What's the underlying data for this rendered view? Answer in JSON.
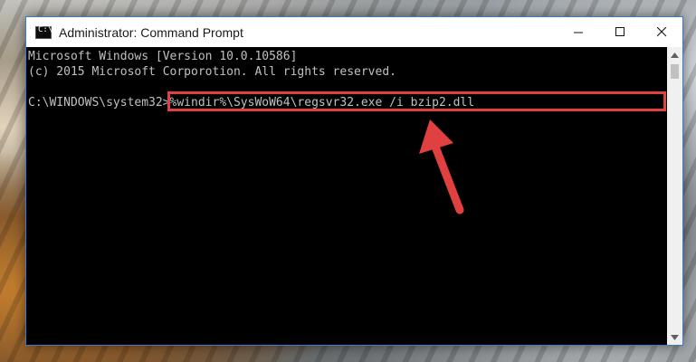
{
  "window": {
    "title": "Administrator: Command Prompt",
    "app_icon_glyph": "C:\\",
    "controls": {
      "minimize_icon": "minimize-icon",
      "maximize_icon": "maximize-icon",
      "close_icon": "close-icon"
    }
  },
  "console": {
    "lines": [
      "Microsoft Windows [Version 10.0.10586]",
      "(c) 2015 Microsoft Corporotion. All rights reserved.",
      "",
      "C:\\WINDOWS\\system32>%windir%\\SysWoW64\\regsvr32.exe /i bzip2.dll"
    ]
  },
  "annotation": {
    "highlight_color": "#e0403f",
    "arrow_icon": "red-arrow-icon"
  },
  "colors": {
    "console_bg": "#000000",
    "console_text": "#c0c0c0",
    "window_border": "#3a7bd5"
  }
}
